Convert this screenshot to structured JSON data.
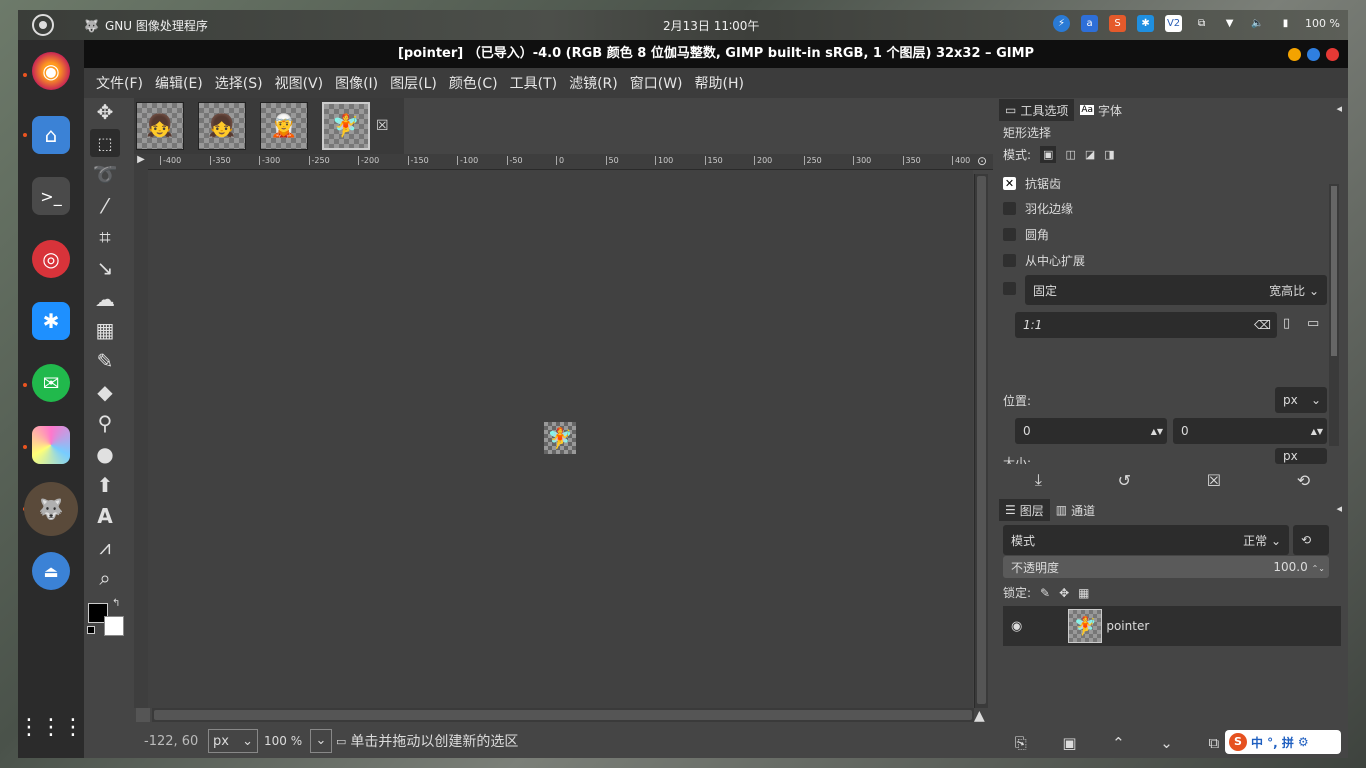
{
  "topbar": {
    "app_name": "GNU 图像处理程序",
    "clock": "2月13日  11∶00午",
    "battery": "100 %"
  },
  "window": {
    "title": "[pointer] （已导入）-4.0 (RGB 颜色 8 位伽马整数, GIMP built-in sRGB, 1 个图层) 32x32 – GIMP"
  },
  "menu": [
    "文件(F)",
    "编辑(E)",
    "选择(S)",
    "视图(V)",
    "图像(I)",
    "图层(L)",
    "颜色(C)",
    "工具(T)",
    "滤镜(R)",
    "窗口(W)",
    "帮助(H)"
  ],
  "ruler": {
    "top_labels": [
      "-400",
      "-350",
      "-300",
      "-250",
      "-200",
      "-150",
      "-100",
      "-50",
      "0",
      "50",
      "100",
      "150",
      "200",
      "250",
      "300",
      "350",
      "400"
    ]
  },
  "status": {
    "coords": "-122, 60",
    "unit": "px",
    "zoom": "100 %",
    "message": "单击并拖动以创建新的选区"
  },
  "tool_options": {
    "tab1": "工具选项",
    "tab2": "字体",
    "title": "矩形选择",
    "mode_label": "模式:",
    "antialias": "抗锯齿",
    "feather": "羽化边缘",
    "rounded": "圆角",
    "expand_center": "从中心扩展",
    "fixed": "固定",
    "fixed_option": "宽高比",
    "ratio": "1:1",
    "position_label": "位置:",
    "position_unit": "px",
    "pos_x": "0",
    "pos_y": "0",
    "size_label": "大小:",
    "size_unit": "px"
  },
  "layers": {
    "tab1": "图层",
    "tab2": "通道",
    "mode_label": "模式",
    "mode_value": "正常",
    "opacity_label": "不透明度",
    "opacity_value": "100.0",
    "lock_label": "锁定:",
    "layer_name": "pointer"
  },
  "ime": {
    "label": "中 °, 拼"
  }
}
